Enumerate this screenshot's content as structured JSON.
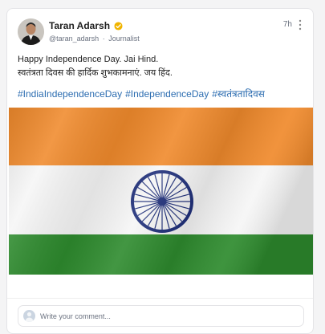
{
  "post": {
    "author_name": "Taran Adarsh",
    "handle": "@taran_adarsh",
    "separator": "·",
    "role": "Journalist",
    "time": "7h",
    "line1": "Happy Independence Day. Jai Hind.",
    "line2": "स्वतंत्रता दिवस की हार्दिक शुभकामनाएं. जय हिंद.",
    "hashtags": [
      "#IndiaIndependenceDay",
      "#IndependenceDay",
      "#स्वतंत्रतादिवस"
    ]
  },
  "comment": {
    "placeholder": "Write your comment..."
  },
  "colors": {
    "hashtag": "#2b6cb0",
    "verified": "#f0b400",
    "saffron": "#f08a2c",
    "green": "#2e8b2e",
    "chakra": "#1f2f7a"
  },
  "icons": {
    "verified": "verified-badge-icon",
    "more": "more-options-icon",
    "avatar": "user-avatar-icon"
  }
}
